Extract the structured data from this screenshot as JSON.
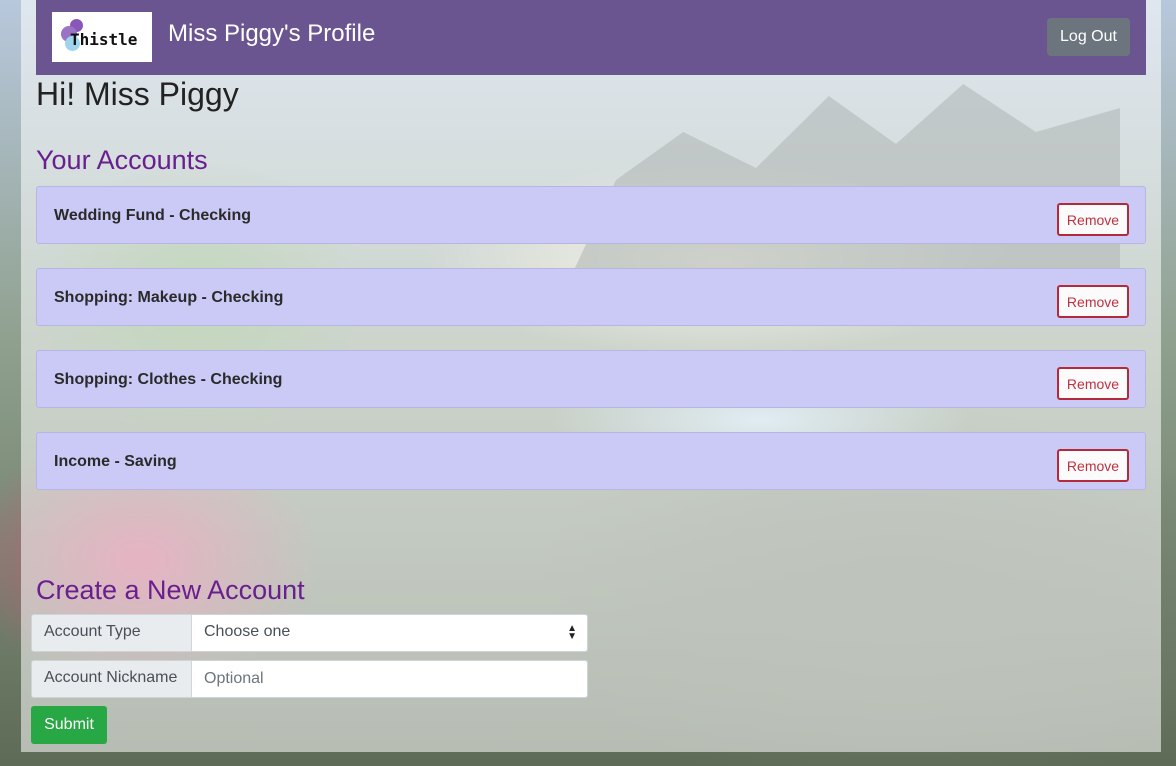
{
  "header": {
    "logo_text": "Thistle",
    "title": "Miss Piggy's Profile",
    "logout_label": "Log Out",
    "bar_color": "#6a5590"
  },
  "greeting": "Hi! Miss Piggy",
  "accounts": {
    "heading": "Your Accounts",
    "items": [
      {
        "label": "Wedding Fund - Checking",
        "remove_label": "Remove"
      },
      {
        "label": "Shopping: Makeup - Checking",
        "remove_label": "Remove"
      },
      {
        "label": "Shopping: Clothes - Checking",
        "remove_label": "Remove"
      },
      {
        "label": "Income - Saving",
        "remove_label": "Remove"
      }
    ]
  },
  "create": {
    "heading": "Create a New Account",
    "type_label": "Account Type",
    "type_value": "Choose one",
    "nickname_label": "Account Nickname",
    "nickname_placeholder": "Optional",
    "submit_label": "Submit"
  }
}
